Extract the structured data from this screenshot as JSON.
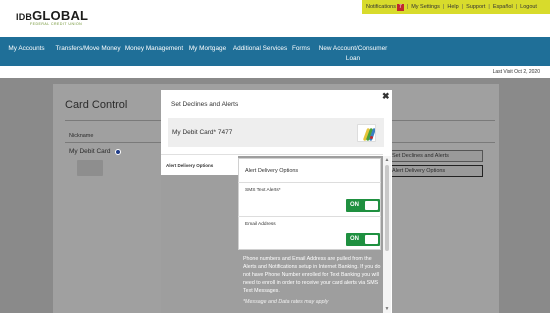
{
  "header": {
    "logo_idb": "IDB",
    "logo_global": "GLOBAL",
    "logo_sub": "FEDERAL CREDIT UNION"
  },
  "utility": {
    "notifications": "Notifications",
    "notifications_count": "7",
    "my_settings": "My Settings",
    "help": "Help",
    "support": "Support",
    "espanol": "Español",
    "logout": "Logout",
    "bar_color": "#d8db2c"
  },
  "nav": {
    "bg_color": "#1f6f98",
    "items": [
      {
        "label": "My Accounts"
      },
      {
        "label": "Transfers/Move Money"
      },
      {
        "label": "Money Management"
      },
      {
        "label": "My Mortgage"
      },
      {
        "label": "Additional Services"
      },
      {
        "label": "Forms"
      },
      {
        "label": "New Account/Consumer Loan"
      }
    ]
  },
  "last_visit": "Last Visit Oct 2, 2020",
  "background_page": {
    "title": "Card Control",
    "nickname_header": "Nickname",
    "card_name": "My Debit Card",
    "info_icon": "info-icon",
    "buttons": [
      "Set Declines and Alerts",
      "Alert Delivery Options"
    ]
  },
  "modal": {
    "title": "Set Declines and Alerts",
    "close_icon": "close-icon",
    "card_label": "My Debit Card* 7477",
    "side_tab": "Alert Delivery Options",
    "options_title": "Alert Delivery Options",
    "options": [
      {
        "label": "SMS Text Alerts*",
        "state": "ON"
      },
      {
        "label": "Email Address",
        "state": "ON"
      }
    ],
    "toggle_color": "#1f9040",
    "info_text": "Phone numbers and Email Address are pulled from the Alerts and Notifications setup in Internet Banking. If you do not have Phone Number enrolled for Text Banking you will need to enroll in order to receive your card alerts via SMS Text Messages.",
    "fine_print": "*Message and Data rates may apply"
  }
}
